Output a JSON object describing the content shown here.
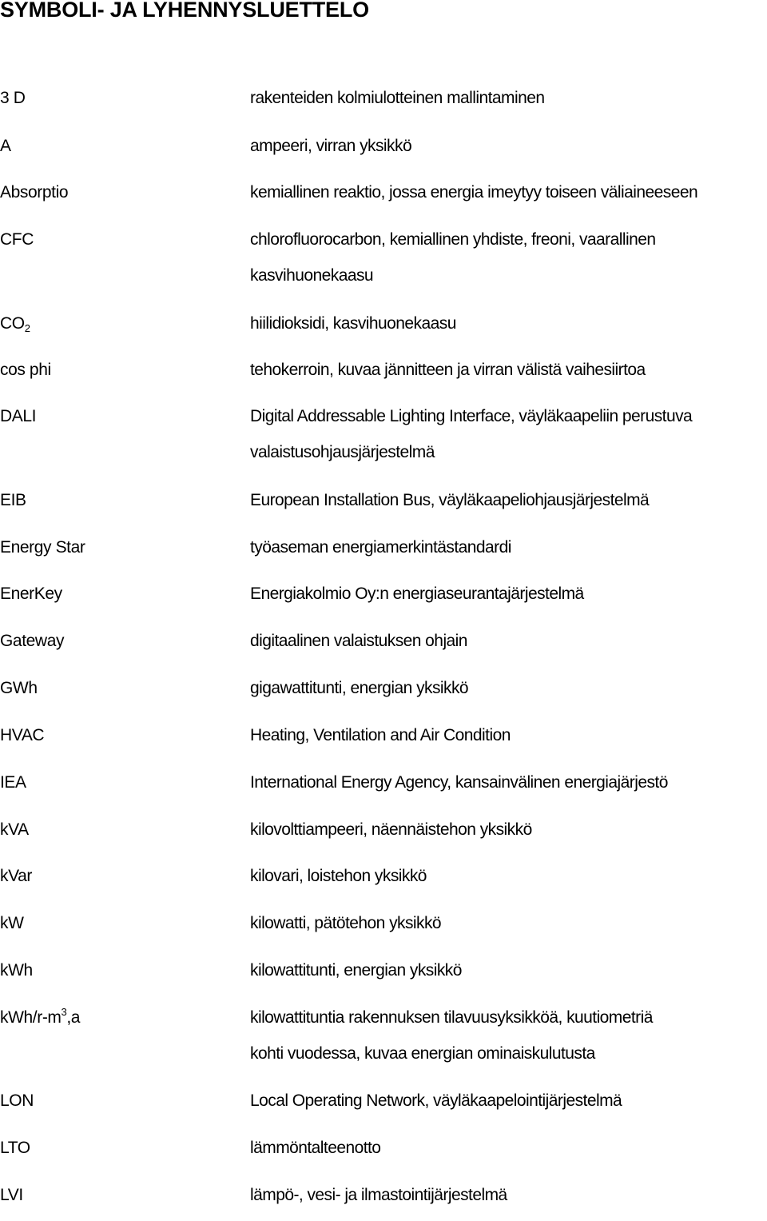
{
  "page": {
    "title": "SYMBOLI- JA LYHENNYSLUETTELO"
  },
  "entries": [
    {
      "term": "3 D",
      "definition": [
        "rakenteiden kolmiulotteinen mallintaminen"
      ]
    },
    {
      "term": "A",
      "definition": [
        "ampeeri, virran yksikkö"
      ]
    },
    {
      "term": "Absorptio",
      "definition": [
        "kemiallinen reaktio, jossa energia imeytyy toiseen väliaineeseen"
      ]
    },
    {
      "term": "CFC",
      "definition": [
        "chlorofluorocarbon, kemiallinen yhdiste, freoni, vaarallinen",
        "kasvihuonekaasu"
      ]
    },
    {
      "term": "CO",
      "term_sub": "2",
      "definition": [
        "hiilidioksidi, kasvihuonekaasu"
      ]
    },
    {
      "term": "cos phi",
      "definition": [
        "tehokerroin, kuvaa jännitteen ja virran välistä vaihesiirtoa"
      ]
    },
    {
      "term": "DALI",
      "definition": [
        "Digital Addressable Lighting Interface, väyläkaapeliin perustuva",
        "valaistusohjausjärjestelmä"
      ]
    },
    {
      "term": "EIB",
      "definition": [
        "European Installation Bus, väyläkaapeliohjausjärjestelmä"
      ]
    },
    {
      "term": "Energy Star",
      "definition": [
        "työaseman energiamerkintästandardi"
      ]
    },
    {
      "term": "EnerKey",
      "definition": [
        "Energiakolmio Oy:n energiaseurantajärjestelmä"
      ]
    },
    {
      "term": "Gateway",
      "definition": [
        "digitaalinen valaistuksen ohjain"
      ]
    },
    {
      "term": "GWh",
      "definition": [
        "gigawattitunti, energian yksikkö"
      ]
    },
    {
      "term": "HVAC",
      "definition": [
        "Heating, Ventilation and Air Condition"
      ]
    },
    {
      "term": "IEA",
      "definition": [
        "International Energy Agency, kansainvälinen energiajärjestö"
      ]
    },
    {
      "term": "kVA",
      "definition": [
        "kilovolttiampeeri, näennäistehon yksikkö"
      ]
    },
    {
      "term": "kVar",
      "definition": [
        "kilovari, loistehon yksikkö"
      ]
    },
    {
      "term": "kW",
      "definition": [
        "kilowatti, pätötehon yksikkö"
      ]
    },
    {
      "term": "kWh",
      "definition": [
        "kilowattitunti, energian yksikkö"
      ]
    },
    {
      "term": "kWh/r-m",
      "term_sup": "3",
      "term_after": ",a",
      "definition": [
        "kilowattituntia rakennuksen tilavuusyksikköä, kuutiometriä",
        "kohti vuodessa, kuvaa energian ominaiskulutusta"
      ]
    },
    {
      "term": "LON",
      "definition": [
        "Local Operating Network, väyläkaapelointijärjestelmä"
      ]
    },
    {
      "term": "LTO",
      "definition": [
        "lämmöntalteenotto"
      ]
    },
    {
      "term": "LVI",
      "definition": [
        "lämpö-, vesi- ja ilmastointijärjestelmä"
      ]
    }
  ]
}
